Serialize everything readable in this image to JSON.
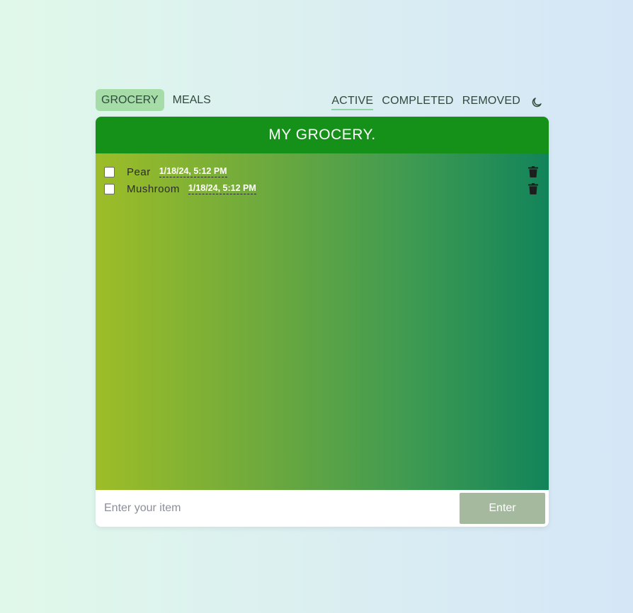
{
  "categories": [
    {
      "label": "GROCERY",
      "active": true
    },
    {
      "label": "MEALS",
      "active": false
    }
  ],
  "filters": [
    {
      "label": "ACTIVE",
      "active": true
    },
    {
      "label": "COMPLETED",
      "active": false
    },
    {
      "label": "REMOVED",
      "active": false
    }
  ],
  "theme_toggle_icon": "moon-icon",
  "card": {
    "title": "MY GROCERY.",
    "header_color": "#159018"
  },
  "items": [
    {
      "name": "Pear",
      "timestamp": "1/18/24, 5:12 PM",
      "checked": false
    },
    {
      "name": "Mushroom",
      "timestamp": "1/18/24, 5:12 PM",
      "checked": false
    }
  ],
  "input": {
    "placeholder": "Enter your item",
    "value": "",
    "button_label": "Enter"
  }
}
